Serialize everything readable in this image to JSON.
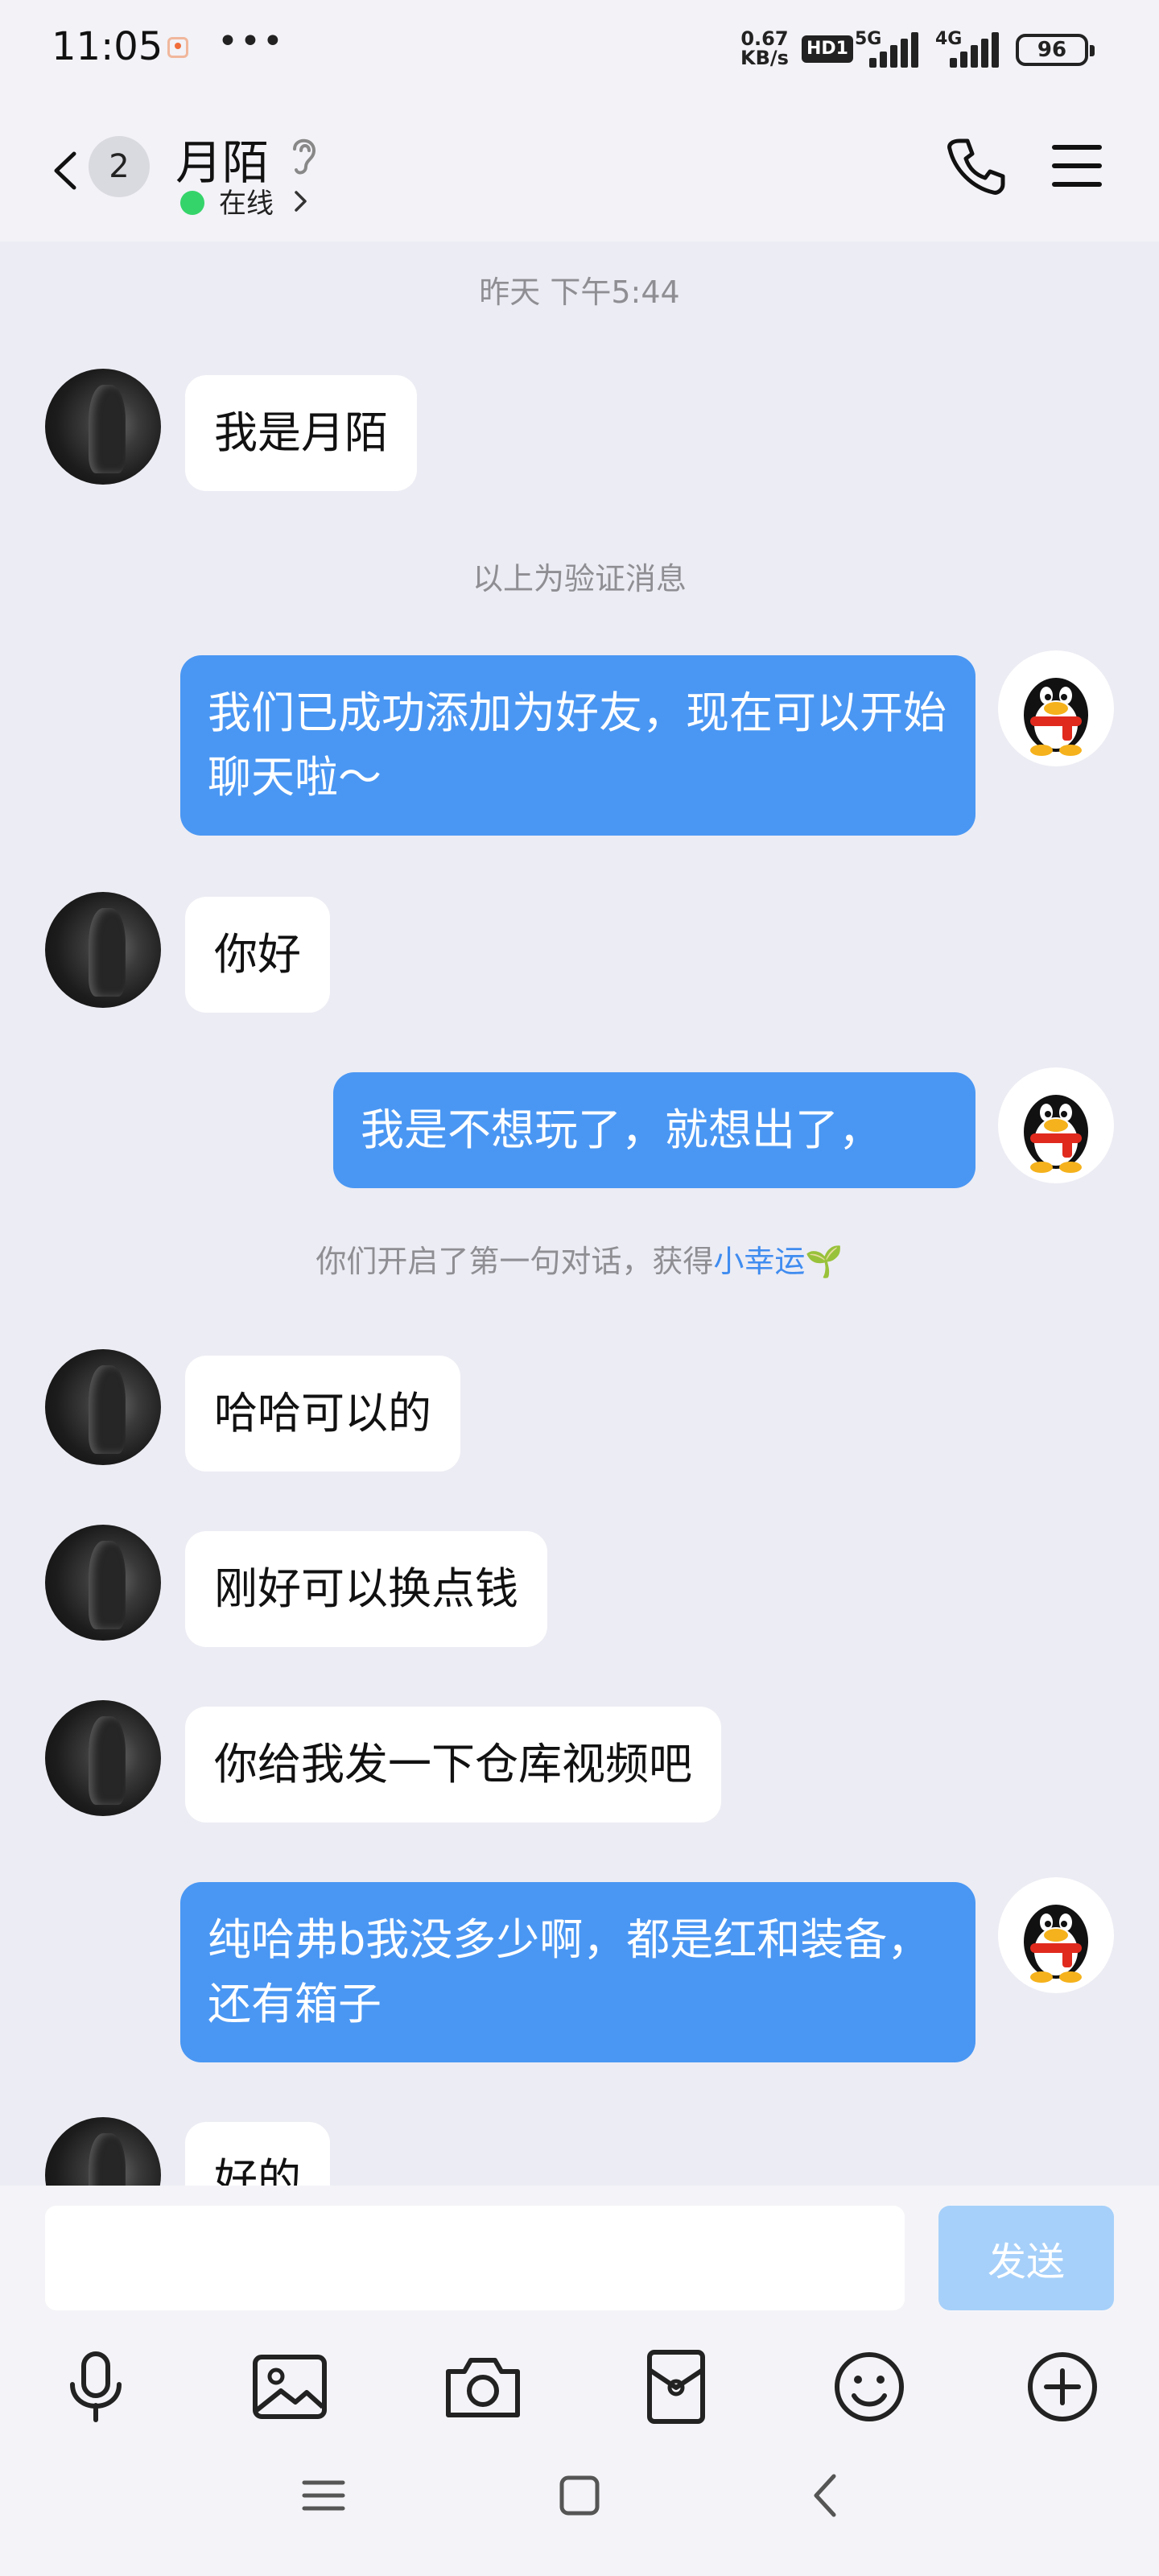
{
  "status_bar": {
    "time": "11:05",
    "more": "•••",
    "speed_value": "0.67",
    "speed_unit": "KB/s",
    "hd": "HD1",
    "net1": "5G",
    "net2": "4G",
    "battery": "96"
  },
  "header": {
    "unread_count": "2",
    "contact_name": "月陌",
    "online_status": "在线"
  },
  "chat": {
    "timestamp": "昨天 下午5:44",
    "verify_note": "以上为验证消息",
    "lucky_prefix": "你们开启了第一句对话，获得",
    "lucky_link": "小幸运",
    "lucky_emoji": "🌱",
    "messages": [
      {
        "side": "in",
        "text": "我是月陌"
      },
      {
        "side": "out",
        "text": "我们已成功添加为好友，现在可以开始聊天啦～"
      },
      {
        "side": "in",
        "text": "你好"
      },
      {
        "side": "out",
        "text": "我是不想玩了，就想出了，"
      },
      {
        "side": "in",
        "text": "哈哈可以的"
      },
      {
        "side": "in",
        "text": "刚好可以换点钱"
      },
      {
        "side": "in",
        "text": "你给我发一下仓库视频吧"
      },
      {
        "side": "out",
        "text": "纯哈弗b我没多少啊，都是红和装备，还有箱子"
      },
      {
        "side": "in",
        "text": "好的"
      }
    ]
  },
  "composer": {
    "input_value": "",
    "send_label": "发送"
  },
  "colors": {
    "outgoing_bubble": "#4a97f3",
    "send_button_disabled": "#a6d0fa",
    "online": "#35d46a",
    "link": "#3f8cf0"
  },
  "icons": {
    "toolbar": [
      "microphone-icon",
      "image-icon",
      "camera-icon",
      "red-packet-icon",
      "emoji-icon",
      "add-icon"
    ],
    "nav": [
      "recents-icon",
      "home-icon",
      "back-icon"
    ]
  }
}
